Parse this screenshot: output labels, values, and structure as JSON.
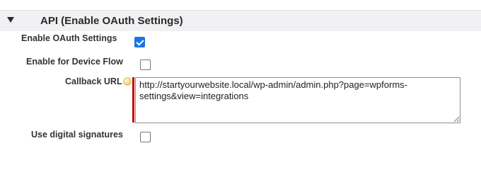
{
  "section": {
    "title": "API (Enable OAuth Settings)"
  },
  "fields": {
    "enable_oauth": {
      "label": "Enable OAuth Settings",
      "checked": true
    },
    "device_flow": {
      "label": "Enable for Device Flow",
      "checked": false
    },
    "callback_url": {
      "label": "Callback URL",
      "value": "http://startyourwebsite.local/wp-admin/admin.php?page=wpforms-settings&view=integrations"
    },
    "digital_signatures": {
      "label": "Use digital signatures",
      "checked": false
    }
  },
  "colors": {
    "header_bg": "#f1f1f3",
    "checkbox_checked": "#1a73e8",
    "required_marker": "#c00000"
  },
  "icons": {
    "toggle": "triangle-down-icon",
    "help": "info-bubble-icon"
  }
}
